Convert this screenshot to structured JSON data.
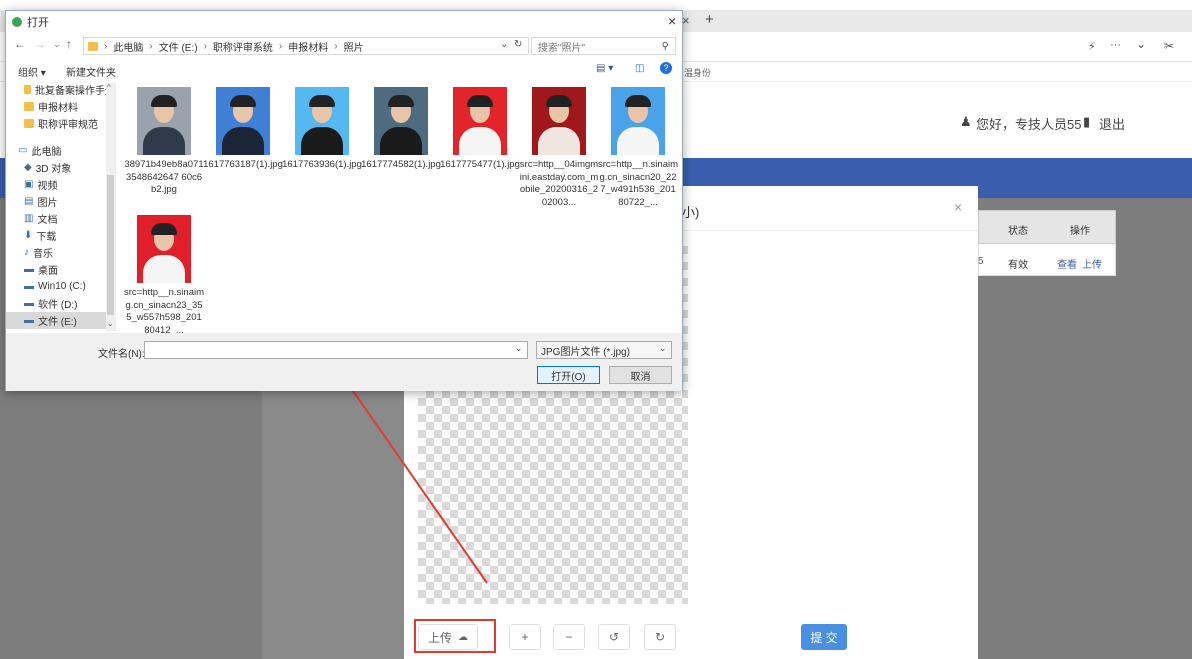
{
  "browser": {
    "tab_close": "×",
    "new_tab": "+",
    "right_icons": [
      "⚡",
      "···",
      "⌄",
      "✂"
    ],
    "bookmark_stub": "温身份"
  },
  "page": {
    "greeting": "您好，专技人员55",
    "logout": "退出",
    "table": {
      "headers": [
        "状态",
        "操作"
      ],
      "row_first_cell_stub": "5",
      "status": "有效",
      "action_view": "查看",
      "action_upload": "上传"
    }
  },
  "modal": {
    "title_stub": "小)",
    "close": "×",
    "upload_label": "上传",
    "zoom_in": "+",
    "zoom_out": "−",
    "rotate_left": "↺",
    "rotate_right": "↻",
    "submit": "提 交"
  },
  "dialog": {
    "title": "打开",
    "close": "×",
    "breadcrumb": [
      "此电脑",
      "文件 (E:)",
      "职称评审系统",
      "申报材料",
      "照片"
    ],
    "search_placeholder": "搜索\"照片\"",
    "organize": "组织 ▾",
    "new_folder": "新建文件夹",
    "sidebar": [
      {
        "label": "批复备案操作手册",
        "icon": "folder-icon"
      },
      {
        "label": "申报材料",
        "icon": "folder-icon"
      },
      {
        "label": "职称评审规范",
        "icon": "folder-icon"
      },
      {
        "label": "此电脑",
        "icon": "computer-icon"
      },
      {
        "label": "3D 对象",
        "icon": "cube-icon"
      },
      {
        "label": "视频",
        "icon": "video-icon"
      },
      {
        "label": "图片",
        "icon": "picture-icon"
      },
      {
        "label": "文档",
        "icon": "document-icon"
      },
      {
        "label": "下载",
        "icon": "download-icon"
      },
      {
        "label": "音乐",
        "icon": "music-icon"
      },
      {
        "label": "桌面",
        "icon": "desktop-icon"
      },
      {
        "label": "Win10 (C:)",
        "icon": "drive-icon"
      },
      {
        "label": "软件 (D:)",
        "icon": "drive-icon"
      },
      {
        "label": "文件 (E:)",
        "icon": "drive-icon"
      }
    ],
    "files": [
      {
        "name": "38971b49eb8a0713548642647 60c6b2.jpg",
        "bg": "#9aa3ad",
        "shirt": "#2f3a4a"
      },
      {
        "name": "1617763187(1).jpg",
        "bg": "#3f7fd6",
        "shirt": "#1b2535"
      },
      {
        "name": "1617763936(1).jpg",
        "bg": "#56b8f0",
        "shirt": "#1a1a1a"
      },
      {
        "name": "1617774582(1).jpg",
        "bg": "#4e6b80",
        "shirt": "#1a1a1a"
      },
      {
        "name": "1617775477(1).jpg",
        "bg": "#e3242b",
        "shirt": "#f5f5f5"
      },
      {
        "name": "src=http__04imgmini.eastday.com_mobile_20200316_202003...",
        "bg": "#a0171c",
        "shirt": "#f0e6e0"
      },
      {
        "name": "src=http__n.sinaimg.cn_sinacn20_227_w491h536_20180722_...",
        "bg": "#4aa3e8",
        "shirt": "#f5f5f5"
      },
      {
        "name": "src=http__n.sinaimg.cn_sinacn23_355_w557h598_20180412_...",
        "bg": "#e01f2a",
        "shirt": "#f5f5f5"
      }
    ],
    "filename_label": "文件名(N):",
    "filename_value": "",
    "filetype": "JPG图片文件 (*.jpg)",
    "open": "打开(O)",
    "cancel": "取消"
  },
  "colors": {
    "brand_blue": "#3b5dae",
    "link_blue": "#3b5dae",
    "annotation_red": "#e03c31",
    "submit_blue": "#4a90e2"
  }
}
